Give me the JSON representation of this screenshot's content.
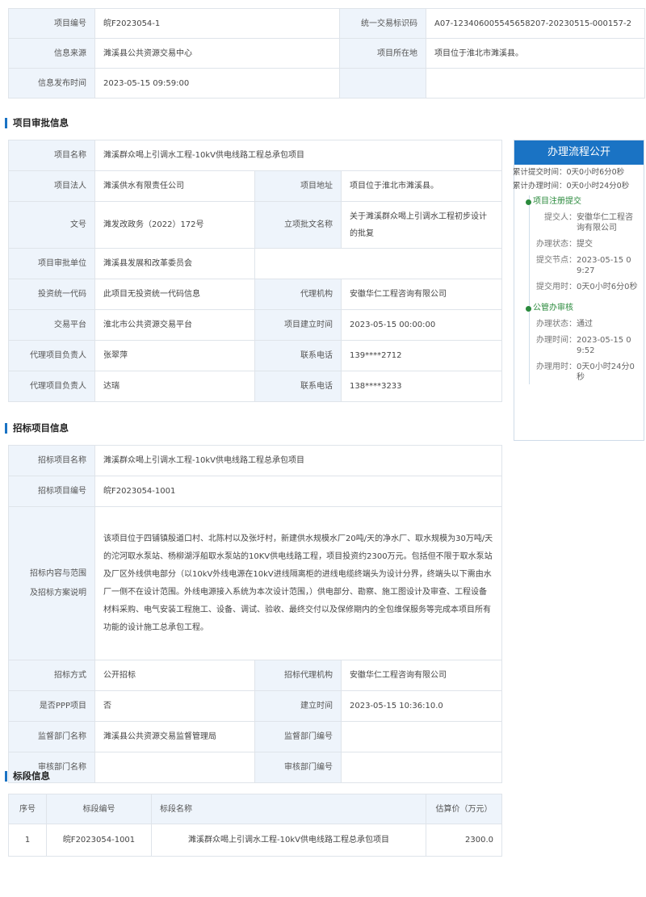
{
  "top_info": {
    "project_no_label": "项目编号",
    "project_no": "皖F2023054-1",
    "trade_code_label": "统一交易标识码",
    "trade_code": "A07-123406005545658207-20230515-000157-2",
    "source_label": "信息来源",
    "source": "濉溪县公共资源交易中心",
    "location_label": "项目所在地",
    "location": "项目位于淮北市濉溪县。",
    "publish_time_label": "信息发布时间",
    "publish_time": "2023-05-15 09:59:00"
  },
  "section_approval": {
    "title": "项目审批信息"
  },
  "approval": {
    "name_label": "项目名称",
    "name": "濉溪群众喝上引调水工程-10kV供电线路工程总承包项目",
    "legal_label": "项目法人",
    "legal": "濉溪供水有限责任公司",
    "address_label": "项目地址",
    "address": "项目位于淮北市濉溪县。",
    "doc_no_label": "文号",
    "doc_no": "濉发改政务（2022）172号",
    "doc_name_label": "立项批文名称",
    "doc_name": "关于濉溪群众喝上引调水工程初步设计的批复",
    "unit_label": "项目审批单位",
    "unit": "濉溪县发展和改革委员会",
    "invest_code_label": "投资统一代码",
    "invest_code": "此项目无投资统一代码信息",
    "agency_label": "代理机构",
    "agency": "安徽华仁工程咨询有限公司",
    "platform_label": "交易平台",
    "platform": "淮北市公共资源交易平台",
    "build_time_label": "项目建立时间",
    "build_time": "2023-05-15 00:00:00",
    "agent_lead1_label": "代理项目负责人",
    "agent_lead1": "张翠萍",
    "phone1_label": "联系电话",
    "phone1": "139****2712",
    "agent_lead2_label": "代理项目负责人",
    "agent_lead2": "达瑞",
    "phone2_label": "联系电话",
    "phone2": "138****3233"
  },
  "section_bid": {
    "title": "招标项目信息"
  },
  "bid": {
    "name_label": "招标项目名称",
    "name": "濉溪群众喝上引调水工程-10kV供电线路工程总承包项目",
    "no_label": "招标项目编号",
    "no": "皖F2023054-1001",
    "scope_label_1": "招标内容与范围",
    "scope_label_2": "及招标方案说明",
    "scope": "该项目位于四铺镇殷道口村、北陈村以及张圩村，新建供水规模水厂20吨/天的净水厂、取水规模为30万吨/天的沱河取水泵站、杨柳湖浮船取水泵站的10KV供电线路工程，项目投资约2300万元。包括但不限于取水泵站及厂区外线供电部分（以10kV外线电源在10kV进线隔离柜的进线电缆终端头为设计分界，终端头以下需由水厂一侧不在设计范围。外线电源接入系统为本次设计范围，）供电部分、勘察、施工图设计及审查、工程设备材料采购、电气安装工程施工、设备、调试、验收、最终交付以及保修期内的全包维保服务等完成本项目所有功能的设计施工总承包工程。",
    "method_label": "招标方式",
    "method": "公开招标",
    "bid_agency_label": "招标代理机构",
    "bid_agency": "安徽华仁工程咨询有限公司",
    "ppp_label": "是否PPP项目",
    "ppp": "否",
    "create_time_label": "建立时间",
    "create_time": "2023-05-15 10:36:10.0",
    "supervisor_label": "监督部门名称",
    "supervisor": "濉溪县公共资源交易监督管理局",
    "supervisor_no_label": "监督部门编号",
    "supervisor_no": "",
    "reviewer_label": "审核部门名称",
    "reviewer": "",
    "reviewer_no_label": "审核部门编号",
    "reviewer_no": ""
  },
  "section_segment": {
    "title": "标段信息"
  },
  "segments": {
    "headers": [
      "序号",
      "标段编号",
      "标段名称",
      "估算价（万元）"
    ],
    "rows": [
      {
        "index": "1",
        "code": "皖F2023054-1001",
        "name": "濉溪群众喝上引调水工程-10kV供电线路工程总承包项目",
        "price": "2300.0"
      }
    ]
  },
  "process": {
    "title": "办理流程公开",
    "total_submit": "累计提交时间：0天0小时6分0秒",
    "total_handle": "累计办理时间：0天0小时24分0秒",
    "stage1": {
      "title": "项目注册提交",
      "submitter_label": "提交人：",
      "submitter": "安徽华仁工程咨询有限公司",
      "status_label": "办理状态：",
      "status": "提交",
      "node_label": "提交节点：",
      "node": "2023-05-15 09:27",
      "used_label": "提交用时：",
      "used": "0天0小时6分0秒"
    },
    "stage2": {
      "title": "公管办审核",
      "status_label": "办理状态：",
      "status": "通过",
      "time_label": "办理时间：",
      "time": "2023-05-15 09:52",
      "used_label": "办理用时：",
      "used": "0天0小时24分0秒"
    }
  }
}
